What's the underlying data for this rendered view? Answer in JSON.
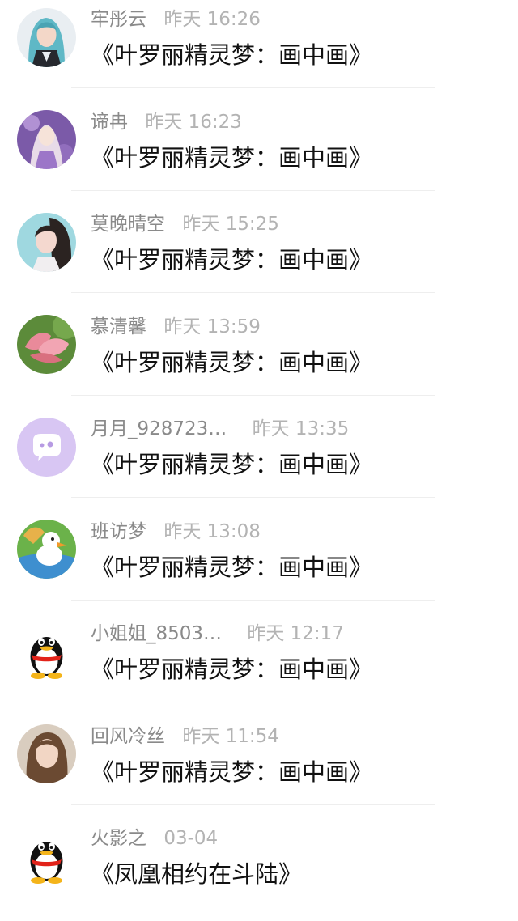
{
  "messages": [
    {
      "name": "牢彤云",
      "time": "昨天 16:26",
      "text": "《叶罗丽精灵梦：画中画》",
      "avatar": "anime-girl-teal-hair-avatar"
    },
    {
      "name": "谛冉",
      "time": "昨天 16:23",
      "text": "《叶罗丽精灵梦：画中画》",
      "avatar": "fantasy-purple-princess-avatar"
    },
    {
      "name": "莫晚晴空",
      "time": "昨天 15:25",
      "text": "《叶罗丽精灵梦：画中画》",
      "avatar": "girl-portrait-avatar"
    },
    {
      "name": "慕清馨",
      "time": "昨天 13:59",
      "text": "《叶罗丽精灵梦：画中画》",
      "avatar": "lotus-flower-avatar"
    },
    {
      "name": "月月_928723…",
      "time": "昨天 13:35",
      "text": "《叶罗丽精灵梦：画中画》",
      "avatar": "purple-chat-bubble-avatar"
    },
    {
      "name": "班访梦",
      "time": "昨天 13:08",
      "text": "《叶罗丽精灵梦：画中画》",
      "avatar": "cartoon-duck-avatar"
    },
    {
      "name": "小姐姐_8503…",
      "time": "昨天 12:17",
      "text": "《叶罗丽精灵梦：画中画》",
      "avatar": "qq-penguin-avatar"
    },
    {
      "name": "回风冷丝",
      "time": "昨天 11:54",
      "text": "《叶罗丽精灵梦：画中画》",
      "avatar": "woman-photo-avatar"
    },
    {
      "name": "火影之",
      "time": "03-04",
      "text": "《凤凰相约在斗陆》",
      "avatar": "qq-penguin-avatar"
    }
  ]
}
